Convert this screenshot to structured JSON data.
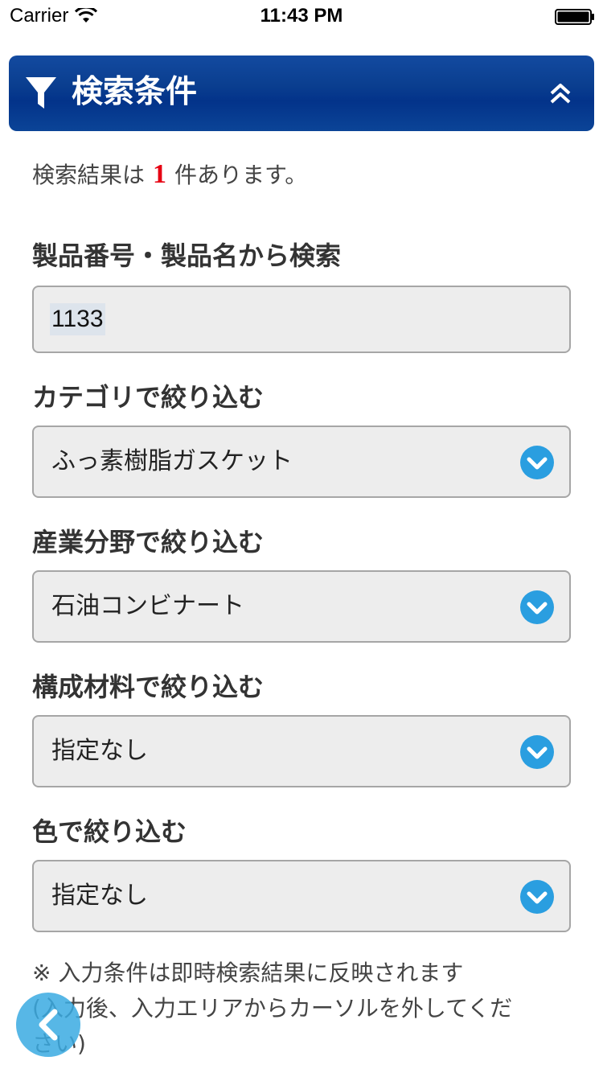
{
  "status_bar": {
    "carrier": "Carrier",
    "time": "11:43 PM",
    "icons": [
      "wifi-icon",
      "battery-icon"
    ]
  },
  "header": {
    "title": "検索条件",
    "icon": "filter-icon",
    "toggle_icon": "chevron-double-up-icon",
    "background_color": "#0a3e8f"
  },
  "result": {
    "prefix": "検索結果は",
    "count": "1",
    "suffix": "件あります。",
    "count_color": "#e60012"
  },
  "search": {
    "label": "製品番号・製品名から検索",
    "value": "1133"
  },
  "filters": [
    {
      "label": "カテゴリで絞り込む",
      "value": "ふっ素樹脂ガスケット"
    },
    {
      "label": "産業分野で絞り込む",
      "value": "石油コンビナート"
    },
    {
      "label": "構成材料で絞り込む",
      "value": "指定なし"
    },
    {
      "label": "色で絞り込む",
      "value": "指定なし"
    }
  ],
  "note": {
    "line1": "※ 入力条件は即時検索結果に反映されます",
    "line2": "(入力後、入力エリアからカーソルを外してくだ",
    "line3": "さい)"
  },
  "back_button": {
    "icon": "chevron-left-icon",
    "color": "#39aae2"
  },
  "dropdown_icon_color": "#2a9ee0"
}
